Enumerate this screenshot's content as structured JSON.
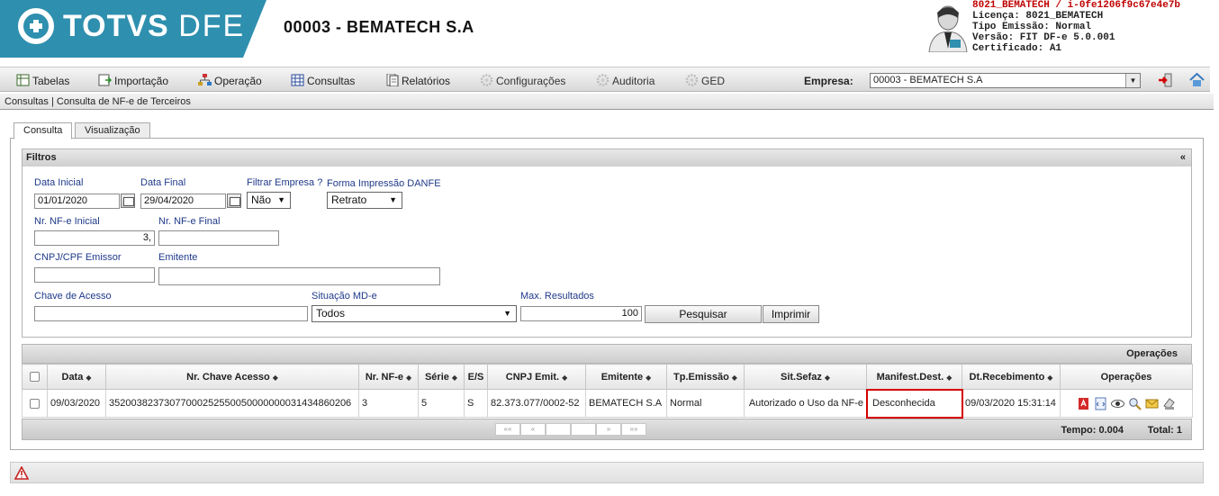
{
  "header": {
    "logo_bold": "TOTVS",
    "logo_light": "DFE",
    "company_title": "00003 - BEMATECH S.A",
    "info_lines": [
      "8021_BEMATECH / i-0fe1206f9c67e4e7b",
      "Licença: 8021_BEMATECH",
      "Tipo Emissão: Normal",
      "Versão: FIT DF-e 5.0.001",
      "Certificado: A1"
    ]
  },
  "menu": {
    "items": [
      {
        "label": "Tabelas",
        "icon": "table-icon"
      },
      {
        "label": "Importação",
        "icon": "import-icon"
      },
      {
        "label": "Operação",
        "icon": "operation-icon"
      },
      {
        "label": "Consultas",
        "icon": "grid-icon"
      },
      {
        "label": "Relatórios",
        "icon": "report-icon"
      },
      {
        "label": "Configurações",
        "icon": "gear-icon"
      },
      {
        "label": "Auditoria",
        "icon": "gear-icon"
      },
      {
        "label": "GED",
        "icon": "gear-icon"
      }
    ],
    "empresa_label": "Empresa:",
    "empresa_value": "00003 - BEMATECH S.A"
  },
  "breadcrumb": "Consultas | Consulta de NF-e de Terceiros",
  "tabs": [
    "Consulta",
    "Visualização"
  ],
  "filters": {
    "title": "Filtros",
    "collapse": "«",
    "data_inicial_label": "Data Inicial",
    "data_inicial_value": "01/01/2020",
    "data_final_label": "Data Final",
    "data_final_value": "29/04/2020",
    "filtrar_empresa_label": "Filtrar Empresa ?",
    "filtrar_empresa_value": "Não",
    "forma_impressao_label": "Forma Impressão DANFE",
    "forma_impressao_value": "Retrato",
    "nr_inicial_label": "Nr. NF-e Inicial",
    "nr_inicial_value": "3,",
    "nr_final_label": "Nr. NF-e Final",
    "nr_final_value": "",
    "cnpj_label": "CNPJ/CPF Emissor",
    "cnpj_value": "",
    "emitente_label": "Emitente",
    "emitente_value": "",
    "chave_label": "Chave de Acesso",
    "chave_value": "",
    "situacao_label": "Situação MD-e",
    "situacao_value": "Todos",
    "max_label": "Max. Resultados",
    "max_value": "100",
    "pesquisar_label": "Pesquisar",
    "imprimir_label": "Imprimir"
  },
  "results": {
    "title": "Operações",
    "columns": [
      "Data",
      "Nr. Chave Acesso",
      "Nr. NF-e",
      "Série",
      "E/S",
      "CNPJ Emit.",
      "Emitente",
      "Tp.Emissão",
      "Sit.Sefaz",
      "Manifest.Dest.",
      "Dt.Recebimento",
      "Operações"
    ],
    "rows": [
      {
        "data": "09/03/2020",
        "chave": "35200382373077000252550050000000031434860206",
        "nr": "3",
        "serie": "5",
        "es": "S",
        "cnpj": "82.373.077/0002-52",
        "emitente": "BEMATECH S.A",
        "tp_emissao": "Normal",
        "sit_sefaz": "Autorizado o Uso da NF-e",
        "manifest": "Desconhecida",
        "dt_recebimento": "09/03/2020 15:31:14"
      }
    ],
    "tempo": "Tempo: 0.004",
    "total": "Total: 1"
  }
}
